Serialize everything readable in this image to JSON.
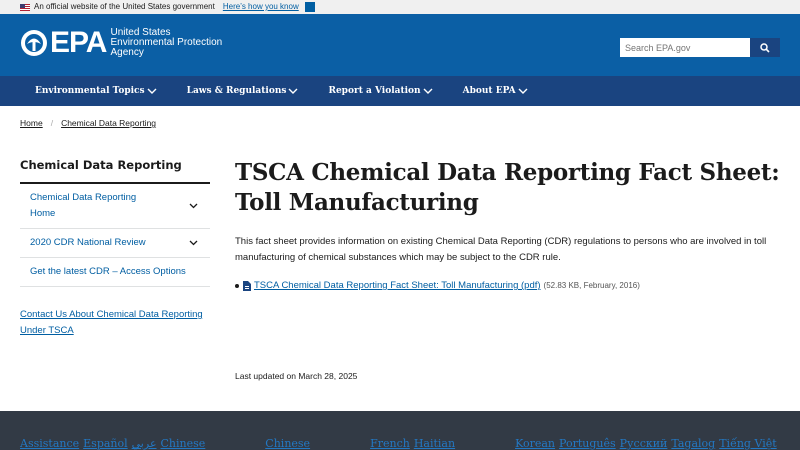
{
  "gov_banner": {
    "text": "An official website of the United States government",
    "link": "Here’s how you know"
  },
  "header": {
    "logo_short": "EPA",
    "logo_line1": "United States",
    "logo_line2": "Environmental Protection",
    "logo_line3": "Agency",
    "search_placeholder": "Search EPA.gov"
  },
  "nav": {
    "items": [
      {
        "label": "Environmental Topics"
      },
      {
        "label": "Laws & Regulations"
      },
      {
        "label": "Report a Violation"
      },
      {
        "label": "About EPA"
      }
    ]
  },
  "breadcrumb": {
    "home": "Home",
    "current": "Chemical Data Reporting"
  },
  "sidebar": {
    "title": "Chemical Data Reporting",
    "items": [
      {
        "label": "Chemical Data Reporting Home"
      },
      {
        "label": "2020 CDR National Review"
      },
      {
        "label": "Get the latest CDR – Access Options"
      }
    ],
    "contact": "Contact Us About Chemical Data Reporting Under TSCA"
  },
  "main": {
    "title": "TSCA Chemical Data Reporting Fact Sheet: Toll Manufacturing",
    "intro": "This fact sheet provides information on existing Chemical Data Reporting (CDR) regulations to persons who are involved in toll manufacturing of chemical substances which may be subject to the CDR rule.",
    "document_link": "TSCA Chemical Data Reporting Fact Sheet: Toll Manufacturing (pdf)",
    "document_meta": "(52.83 KB, February, 2016)",
    "last_updated": "Last updated on March 28, 2025"
  },
  "footer": {
    "links": [
      "Assistance",
      "Español",
      "عربي",
      "Chinese",
      "Chinese",
      "French",
      "Haitian",
      "Korean",
      "Português",
      "Русский",
      "Tagalog",
      "Tiếng Việt"
    ]
  },
  "colors": {
    "header_blue": "#0b5fa5",
    "nav_navy": "#1a4480",
    "link_blue": "#005ea2",
    "footer_dark": "#323a45"
  }
}
